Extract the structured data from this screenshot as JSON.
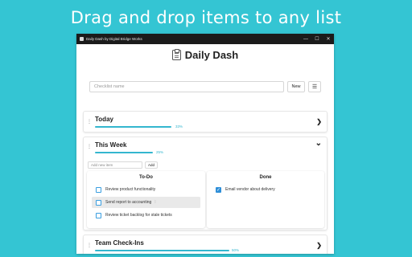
{
  "banner": "Drag and drop items to any list",
  "window": {
    "title": "Daily Dash by Digital Bridge Works",
    "controls": [
      "—",
      "☐",
      "✕"
    ]
  },
  "app": {
    "title": "Daily Dash",
    "icon": "clipboard-icon"
  },
  "toolbar": {
    "name_placeholder": "Checklist name",
    "new_label": "New",
    "menu_label": "☰"
  },
  "accent_color": "#34b6cf",
  "lists": [
    {
      "title": "Today",
      "progress_label": "33%",
      "progress": 0.33,
      "expanded": false,
      "chevron": "❯"
    },
    {
      "title": "This Week",
      "progress_label": "25%",
      "progress": 0.25,
      "expanded": true,
      "chevron": "⌄",
      "add_placeholder": "Add new item",
      "add_label": "Add",
      "todo": {
        "title": "To-Do",
        "items": [
          {
            "text": "Review product functionality",
            "checked": false
          },
          {
            "text": "Send report to accounting",
            "checked": false,
            "highlighted": true
          },
          {
            "text": "Review ticket backlog for stale tickets",
            "checked": false
          }
        ]
      },
      "done": {
        "title": "Done",
        "items": [
          {
            "text": "Email vendor about delivery",
            "checked": true
          }
        ]
      }
    },
    {
      "title": "Team Check-Ins",
      "progress_label": "50%",
      "progress": 0.5,
      "expanded": false,
      "chevron": "❯"
    }
  ],
  "drag_handle": "⋮",
  "item_grip": "⁞",
  "checkmark": "✓"
}
